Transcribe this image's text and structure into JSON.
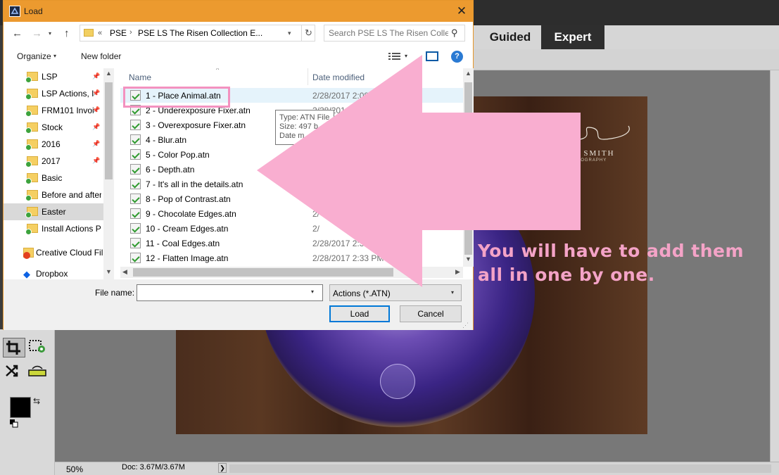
{
  "pse": {
    "tabs": [
      {
        "label": "Guided"
      },
      {
        "label": "Expert",
        "active": true
      }
    ],
    "status": {
      "zoom": "50%",
      "doc": "Doc: 3.67M/3.67M",
      "arrow": "❯"
    },
    "photo": {
      "logo": "SAY SMITH",
      "logo_sub": "OTOGRAPHY"
    },
    "tools": [
      {
        "name": "crop-tool"
      },
      {
        "name": "cookie-cutter-tool"
      },
      {
        "name": "content-aware-move-tool"
      },
      {
        "name": "straighten-tool"
      }
    ],
    "colors": {
      "foreground": "#000000",
      "background": "#ffffff"
    }
  },
  "dialog": {
    "title": "Load",
    "close_glyph": "✕",
    "nav": {
      "back": "←",
      "forward": "→",
      "recent": "▾",
      "up": "↑",
      "address": {
        "chevrons": "«",
        "crumbs": [
          "PSE",
          "PSE LS The Risen Collection E..."
        ],
        "separator": "›",
        "dropdown": "▾",
        "refresh": "↻"
      },
      "search_placeholder": "Search PSE LS The Risen Colle...",
      "search_glyph": "⚲"
    },
    "toolbar": {
      "organize": "Organize",
      "caret": "▾",
      "new_folder": "New folder",
      "help": "?"
    },
    "sidebar": {
      "items": [
        {
          "label": "LSP",
          "pinned": true
        },
        {
          "label": "LSP Actions, I",
          "pinned": true
        },
        {
          "label": "FRM101 Invoi",
          "pinned": true
        },
        {
          "label": "Stock",
          "pinned": true
        },
        {
          "label": "2016",
          "pinned": true
        },
        {
          "label": "2017",
          "pinned": true
        },
        {
          "label": "Basic",
          "pinned": false
        },
        {
          "label": "Before and after",
          "pinned": false
        },
        {
          "label": "Easter",
          "pinned": false,
          "selected": true
        },
        {
          "label": "Install Actions PS",
          "pinned": false
        }
      ],
      "pin_glyph": "📌",
      "creative_cloud": "Creative Cloud Fil",
      "dropbox": "Dropbox",
      "dropbox_glyph": "◆"
    },
    "columns": {
      "name": "Name",
      "date": "Date modified",
      "sort_glyph": "^"
    },
    "files": [
      {
        "name": "1 - Place Animal.atn",
        "date": "2/28/2017 2:08",
        "type": "le"
      },
      {
        "name": "2 - Underexposure Fixer.atn",
        "date": "2/28/201",
        "type": "le"
      },
      {
        "name": "3 - Overexposure Fixer.atn",
        "date": "",
        "type": ""
      },
      {
        "name": "4 - Blur.atn",
        "date": "",
        "type": ""
      },
      {
        "name": "5 - Color Pop.atn",
        "date": "",
        "type": ""
      },
      {
        "name": "6 - Depth.atn",
        "date": "",
        "type": ""
      },
      {
        "name": "7 - It's all in the details.atn",
        "date": "",
        "type": ""
      },
      {
        "name": "8 - Pop of Contrast.atn",
        "date": "",
        "type": ""
      },
      {
        "name": "9 - Chocolate Edges.atn",
        "date": "2/",
        "type": ""
      },
      {
        "name": "10 - Cream Edges.atn",
        "date": "2/",
        "type": ""
      },
      {
        "name": "11 - Coal Edges.atn",
        "date": "2/28/2017 2:3",
        "type": "le"
      },
      {
        "name": "12 - Flatten Image.atn",
        "date": "2/28/2017 2:33 PM",
        "type": "le"
      }
    ],
    "tooltip": [
      "Type: ATN File",
      "Size: 497 b",
      "Date m"
    ],
    "scroll_glyphs": {
      "up": "▲",
      "down": "▼",
      "left": "◀",
      "right": "▶"
    },
    "footer": {
      "filename_label": "File name:",
      "filename_value": "",
      "filename_caret": "▾",
      "filetype": "Actions (*.ATN)",
      "filetype_caret": "▾",
      "load": "Load",
      "cancel": "Cancel",
      "grip": "⋰"
    }
  },
  "annotation": {
    "text": "You will have to add them all in one by one.",
    "color": "#f4a3c7",
    "arrow_color": "#f9aed0"
  }
}
